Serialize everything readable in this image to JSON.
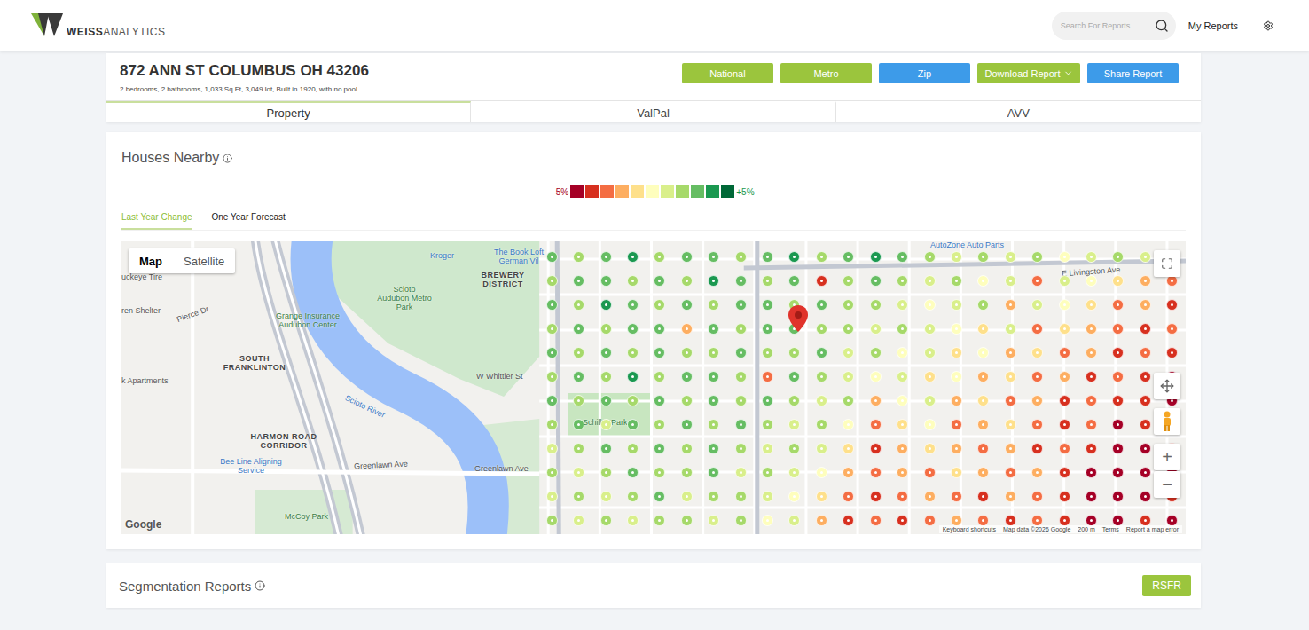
{
  "header": {
    "logo": {
      "bold": "WEISS",
      "light": "ANALYTICS"
    },
    "search": {
      "placeholder": "Search For Reports..."
    },
    "nav": [
      "My Reports"
    ]
  },
  "property": {
    "address": "872 ANN ST COLUMBUS OH 43206",
    "details": "2 bedrooms, 2 bathrooms, 1,033 Sq Ft, 3,049 lot, Built in 1920, with no pool"
  },
  "actions": [
    {
      "label": "National",
      "kind": "scope",
      "selected": false,
      "color": "#9bc53d"
    },
    {
      "label": "Metro",
      "kind": "scope",
      "selected": false,
      "color": "#9bc53d"
    },
    {
      "label": "Zip",
      "kind": "scope",
      "selected": true,
      "color": "#3d9be9"
    },
    {
      "label": "Download Report",
      "kind": "dropdown",
      "selected": false,
      "color": "#9bc53d"
    },
    {
      "label": "Share Report",
      "kind": "button",
      "selected": false,
      "color": "#3d9be9"
    }
  ],
  "tabs": [
    {
      "label": "Property",
      "selected": true
    },
    {
      "label": "ValPal",
      "selected": false
    },
    {
      "label": "AVV",
      "selected": false
    }
  ],
  "houses_nearby": {
    "title": "Houses Nearby",
    "legend": {
      "min": "-5%",
      "max": "+5%",
      "colors": [
        "#a50026",
        "#d7301f",
        "#f46d43",
        "#fdae61",
        "#fee08b",
        "#fefebd",
        "#d9ef8b",
        "#a6d96a",
        "#66bd63",
        "#1a9850",
        "#006837"
      ]
    },
    "subtabs": [
      {
        "label": "Last Year Change",
        "selected": true
      },
      {
        "label": "One Year Forecast",
        "selected": false
      }
    ],
    "map": {
      "type_toggle": [
        {
          "label": "Map",
          "selected": true
        },
        {
          "label": "Satellite",
          "selected": false
        }
      ],
      "labels": [
        {
          "text": "uckeye Tire",
          "kind": "poi"
        },
        {
          "text": "ren Shelter",
          "kind": "poi"
        },
        {
          "text": "Pierce Dr",
          "kind": "road"
        },
        {
          "text": "Scioto Audubon Metro Park",
          "kind": "park"
        },
        {
          "text": "Grange Insurance Audubon Center",
          "kind": "park"
        },
        {
          "text": "SOUTH FRANKLINTON",
          "kind": "area"
        },
        {
          "text": "k Apartments",
          "kind": "poi"
        },
        {
          "text": "Scioto River",
          "kind": "water"
        },
        {
          "text": "HARMON ROAD CORRIDOR",
          "kind": "area"
        },
        {
          "text": "Bee Line Aligning Service",
          "kind": "shop"
        },
        {
          "text": "Greenlawn Ave",
          "kind": "road"
        },
        {
          "text": "Greenlawn Ave",
          "kind": "road"
        },
        {
          "text": "McCoy Park",
          "kind": "park"
        },
        {
          "text": "BREWERY DISTRICT",
          "kind": "area"
        },
        {
          "text": "Kroger",
          "kind": "shop"
        },
        {
          "text": "The Book Loft German Vil",
          "kind": "shop"
        },
        {
          "text": "Schiller Park",
          "kind": "park"
        },
        {
          "text": "AutoZone Auto Parts",
          "kind": "shop"
        },
        {
          "text": "E Livingston Ave",
          "kind": "road"
        },
        {
          "text": "W Whittier St",
          "kind": "road"
        }
      ],
      "attribution": {
        "logo": "Google",
        "items": [
          "Keyboard shortcuts",
          "Map data ©2026 Google",
          "200 m",
          "Terms",
          "Report a map error"
        ]
      },
      "zoom": [
        "+",
        "−"
      ],
      "houses": [
        [
          3,
          2,
          3,
          4,
          2,
          3,
          3,
          2,
          3,
          4,
          2,
          3,
          4,
          3,
          2,
          1,
          2,
          1,
          2,
          0,
          1,
          2,
          1,
          0
        ],
        [
          2,
          3,
          3,
          2,
          3,
          2,
          4,
          3,
          2,
          3,
          -4,
          2,
          3,
          2,
          1,
          2,
          0,
          1,
          -3,
          1,
          0,
          -1,
          -2,
          -3
        ],
        [
          3,
          2,
          4,
          3,
          2,
          3,
          2,
          3,
          3,
          2,
          3,
          2,
          2,
          1,
          0,
          1,
          2,
          -2,
          1,
          0,
          -1,
          -3,
          -2,
          -4
        ],
        [
          2,
          3,
          2,
          3,
          3,
          -2,
          3,
          2,
          3,
          3,
          2,
          2,
          1,
          2,
          1,
          0,
          -1,
          1,
          -3,
          -1,
          -2,
          -3,
          -4,
          -3
        ],
        [
          3,
          2,
          3,
          2,
          3,
          2,
          2,
          3,
          2,
          2,
          3,
          1,
          2,
          0,
          1,
          -1,
          0,
          -2,
          -1,
          -3,
          -2,
          -4,
          -3,
          -4
        ],
        [
          2,
          3,
          2,
          4,
          2,
          3,
          3,
          2,
          -3,
          3,
          2,
          1,
          0,
          1,
          -1,
          0,
          -2,
          -1,
          -3,
          -2,
          -4,
          -3,
          -4,
          -5
        ],
        [
          3,
          2,
          3,
          2,
          3,
          2,
          3,
          2,
          3,
          2,
          1,
          2,
          -2,
          0,
          1,
          -2,
          -1,
          -3,
          -2,
          -4,
          -3,
          -4,
          -4,
          -5
        ],
        [
          2,
          3,
          1,
          3,
          2,
          3,
          2,
          3,
          2,
          1,
          2,
          0,
          -3,
          -1,
          0,
          -3,
          -2,
          -1,
          -3,
          -4,
          -3,
          -5,
          -4,
          -4
        ],
        [
          1,
          2,
          3,
          2,
          3,
          2,
          3,
          2,
          1,
          2,
          1,
          -1,
          -4,
          -2,
          -1,
          -2,
          -3,
          -2,
          -4,
          -3,
          -4,
          -5,
          -5,
          -4
        ],
        [
          2,
          1,
          2,
          3,
          2,
          2,
          3,
          1,
          2,
          1,
          0,
          -2,
          -3,
          -2,
          -3,
          -1,
          -2,
          -3,
          -2,
          -4,
          -5,
          -5,
          -5,
          -5
        ],
        [
          1,
          2,
          1,
          2,
          3,
          1,
          2,
          2,
          1,
          0,
          -1,
          -3,
          -4,
          -3,
          -2,
          -3,
          -4,
          -2,
          -3,
          -4,
          -5,
          -5,
          -5,
          -4
        ],
        [
          2,
          1,
          2,
          1,
          2,
          2,
          1,
          2,
          0,
          1,
          -2,
          -4,
          -3,
          -4,
          -3,
          -2,
          -3,
          -4,
          -3,
          -4,
          -5,
          -5,
          -4,
          -5
        ]
      ]
    }
  },
  "segmentation": {
    "title": "Segmentation Reports",
    "button": "RSFR"
  }
}
